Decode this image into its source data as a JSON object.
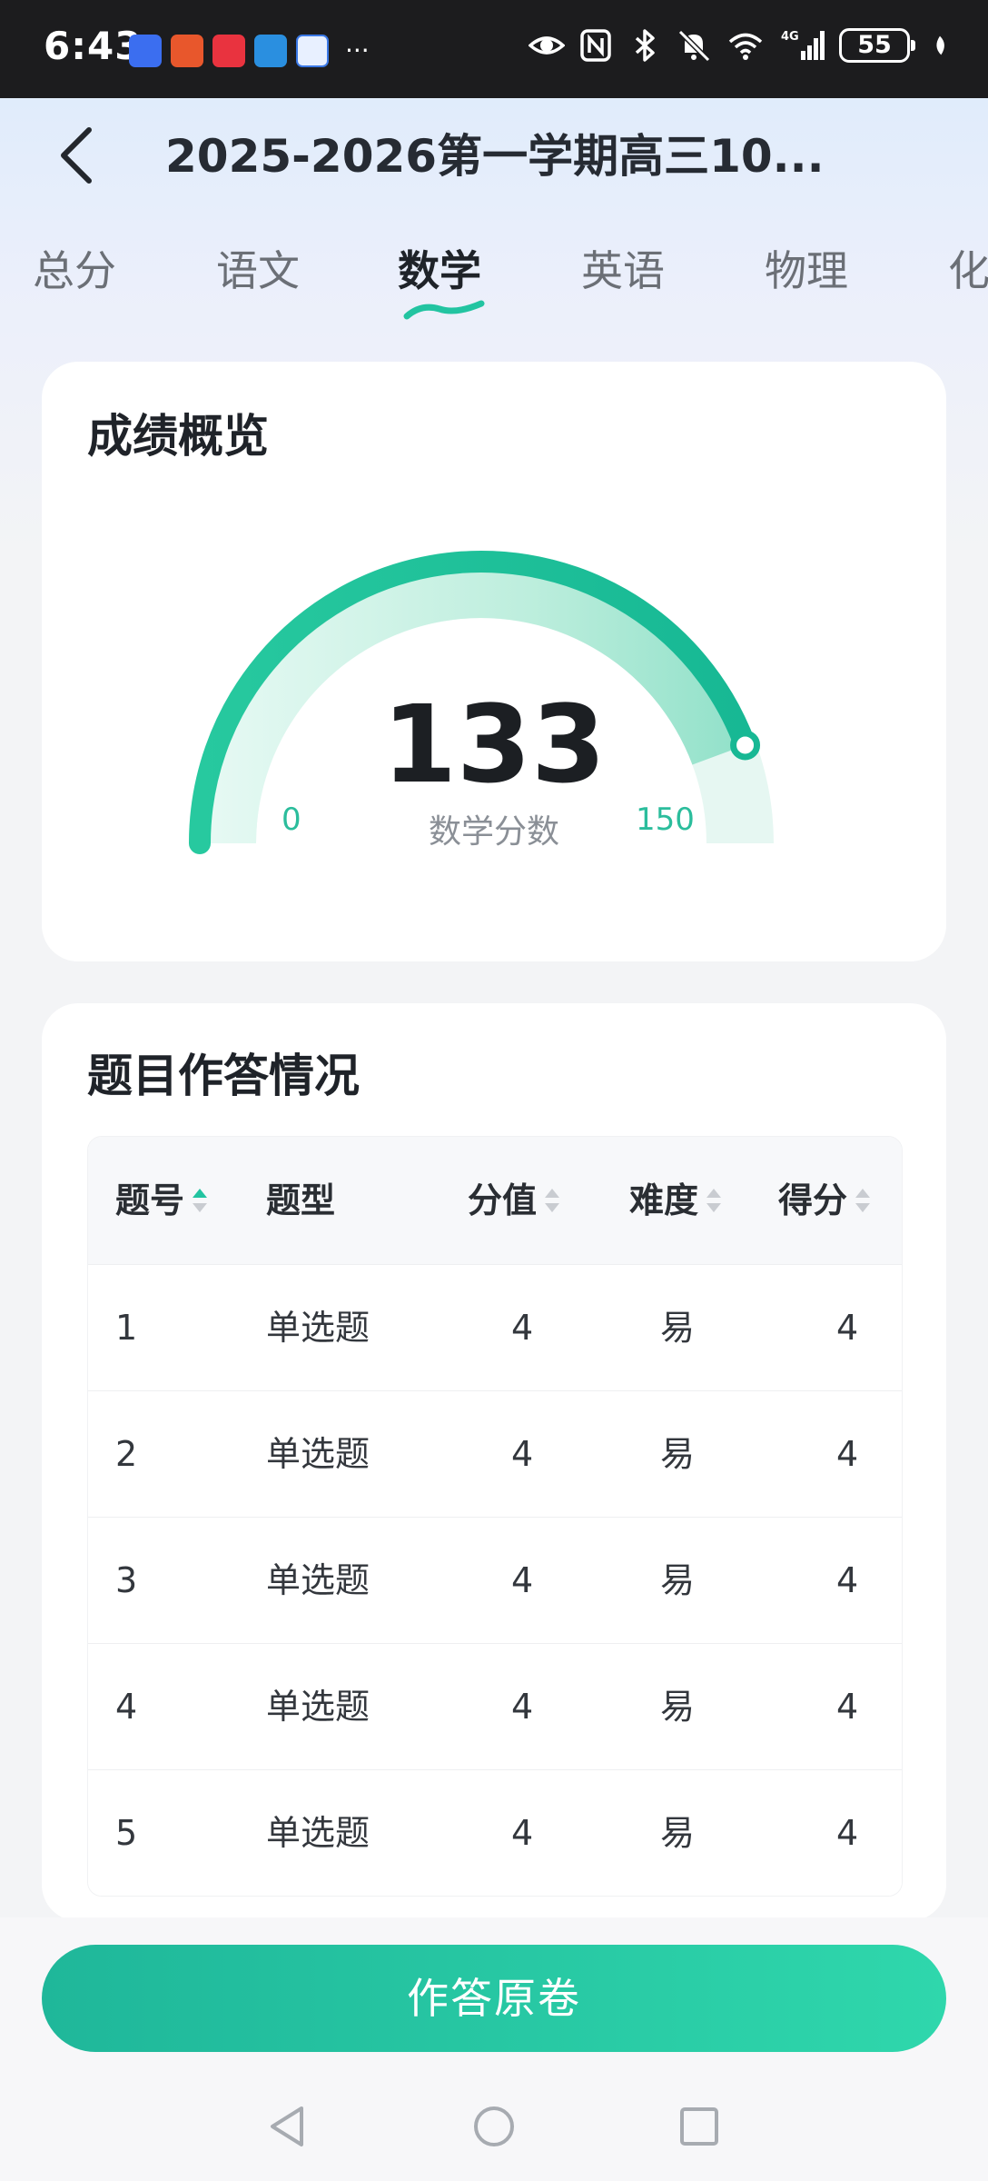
{
  "status_bar": {
    "time": "6:43",
    "more": "···",
    "battery": "55",
    "icons": [
      "eye-icon",
      "nfc-icon",
      "bluetooth-icon",
      "mute-bell-icon",
      "wifi-icon",
      "signal-icon",
      "battery-icon",
      "leaf-icon"
    ]
  },
  "header": {
    "title": "2025-2026第一学期高三10..."
  },
  "tabs": [
    {
      "label": "总分"
    },
    {
      "label": "语文"
    },
    {
      "label": "数学"
    },
    {
      "label": "英语"
    },
    {
      "label": "物理"
    },
    {
      "label": "化"
    }
  ],
  "active_tab": 2,
  "overview": {
    "title": "成绩概览",
    "score": "133",
    "score_label": "数学分数",
    "min": "0",
    "max": "150",
    "score_value": 133,
    "max_value": 150
  },
  "answers": {
    "title": "题目作答情况",
    "columns": [
      "题号",
      "题型",
      "分值",
      "难度",
      "得分"
    ],
    "rows": [
      [
        "1",
        "单选题",
        "4",
        "易",
        "4"
      ],
      [
        "2",
        "单选题",
        "4",
        "易",
        "4"
      ],
      [
        "3",
        "单选题",
        "4",
        "易",
        "4"
      ],
      [
        "4",
        "单选题",
        "4",
        "易",
        "4"
      ],
      [
        "5",
        "单选题",
        "4",
        "易",
        "4"
      ]
    ]
  },
  "footer": {
    "button_label": "作答原卷"
  },
  "colors": {
    "accent": "#1fc3a0",
    "accent_light": "#c9f1e6",
    "gauge_track": "#e3f6f1"
  }
}
